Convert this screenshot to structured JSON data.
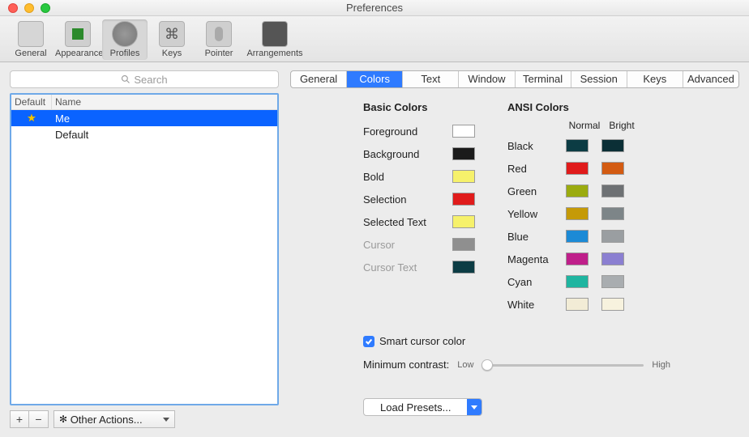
{
  "window": {
    "title": "Preferences"
  },
  "toolbar": [
    {
      "id": "general",
      "label": "General"
    },
    {
      "id": "appearance",
      "label": "Appearance"
    },
    {
      "id": "profiles",
      "label": "Profiles",
      "active": true
    },
    {
      "id": "keys",
      "label": "Keys"
    },
    {
      "id": "pointer",
      "label": "Pointer"
    },
    {
      "id": "arrangements",
      "label": "Arrangements"
    }
  ],
  "search": {
    "placeholder": "Search"
  },
  "profile_list": {
    "headers": {
      "default": "Default",
      "name": "Name"
    },
    "rows": [
      {
        "star": true,
        "name": "Me",
        "selected": true
      },
      {
        "star": false,
        "name": "Default",
        "selected": false
      }
    ]
  },
  "bottom": {
    "add": "+",
    "remove": "−",
    "other_label": "Other Actions..."
  },
  "tabs": [
    {
      "id": "general",
      "label": "General"
    },
    {
      "id": "colors",
      "label": "Colors",
      "active": true
    },
    {
      "id": "text",
      "label": "Text"
    },
    {
      "id": "window",
      "label": "Window"
    },
    {
      "id": "terminal",
      "label": "Terminal"
    },
    {
      "id": "session",
      "label": "Session"
    },
    {
      "id": "keys",
      "label": "Keys"
    },
    {
      "id": "advanced",
      "label": "Advanced"
    }
  ],
  "basic": {
    "header": "Basic Colors",
    "rows": [
      {
        "label": "Foreground",
        "color": "#ffffff",
        "dim": false
      },
      {
        "label": "Background",
        "color": "#1b1b1b",
        "dim": false
      },
      {
        "label": "Bold",
        "color": "#f6f16b",
        "dim": false
      },
      {
        "label": "Selection",
        "color": "#e01b1b",
        "dim": false
      },
      {
        "label": "Selected Text",
        "color": "#f6f16b",
        "dim": false
      },
      {
        "label": "Cursor",
        "color": "#8f8f8f",
        "dim": true
      },
      {
        "label": "Cursor Text",
        "color": "#0c3c44",
        "dim": true
      }
    ]
  },
  "ansi": {
    "header": "ANSI Colors",
    "col_normal": "Normal",
    "col_bright": "Bright",
    "rows": [
      {
        "label": "Black",
        "normal": "#0c3c44",
        "bright": "#0b2f36"
      },
      {
        "label": "Red",
        "normal": "#e01b1b",
        "bright": "#d35b12"
      },
      {
        "label": "Green",
        "normal": "#9bab0f",
        "bright": "#6e7174"
      },
      {
        "label": "Yellow",
        "normal": "#c59a07",
        "bright": "#7d8588"
      },
      {
        "label": "Blue",
        "normal": "#1c8ad6",
        "bright": "#9a9ea1"
      },
      {
        "label": "Magenta",
        "normal": "#bf1f8a",
        "bright": "#8b7fd1"
      },
      {
        "label": "Cyan",
        "normal": "#1fb5a0",
        "bright": "#a9adb0"
      },
      {
        "label": "White",
        "normal": "#f2ecd6",
        "bright": "#f7f2de"
      }
    ]
  },
  "smart": {
    "label": "Smart cursor color",
    "checked": true
  },
  "contrast": {
    "label": "Minimum contrast:",
    "low": "Low",
    "high": "High",
    "value": 0
  },
  "load": {
    "label": "Load Presets..."
  }
}
